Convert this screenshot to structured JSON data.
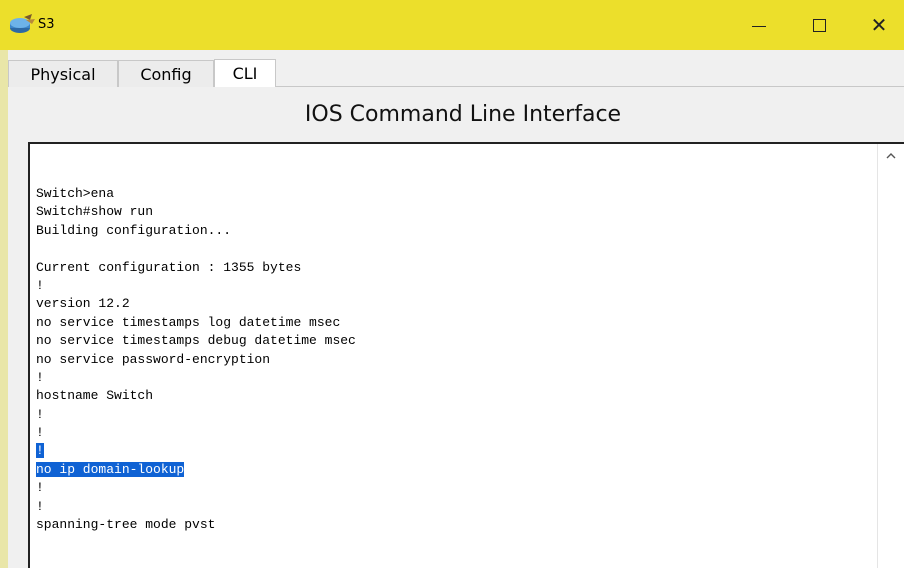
{
  "window": {
    "title": "S3",
    "icon": "router-app-icon",
    "controls": {
      "minimize": "minimize-icon",
      "maximize": "maximize-icon",
      "close": "close-icon"
    }
  },
  "tabs": [
    {
      "label": "Physical",
      "selected": false
    },
    {
      "label": "Config",
      "selected": false
    },
    {
      "label": "CLI",
      "selected": true
    }
  ],
  "cli": {
    "heading": "IOS Command Line Interface",
    "lines": [
      "Switch>ena",
      "Switch#show run",
      "Building configuration...",
      "",
      "Current configuration : 1355 bytes",
      "!",
      "version 12.2",
      "no service timestamps log datetime msec",
      "no service timestamps debug datetime msec",
      "no service password-encryption",
      "!",
      "hostname Switch",
      "!",
      "!",
      "!",
      "no ip domain-lookup",
      "!",
      "!",
      "spanning-tree mode pvst"
    ],
    "selected_line_indexes": [
      14,
      15
    ]
  },
  "colors": {
    "titlebar": "#ecdf2b",
    "selection": "#0f62d4"
  }
}
